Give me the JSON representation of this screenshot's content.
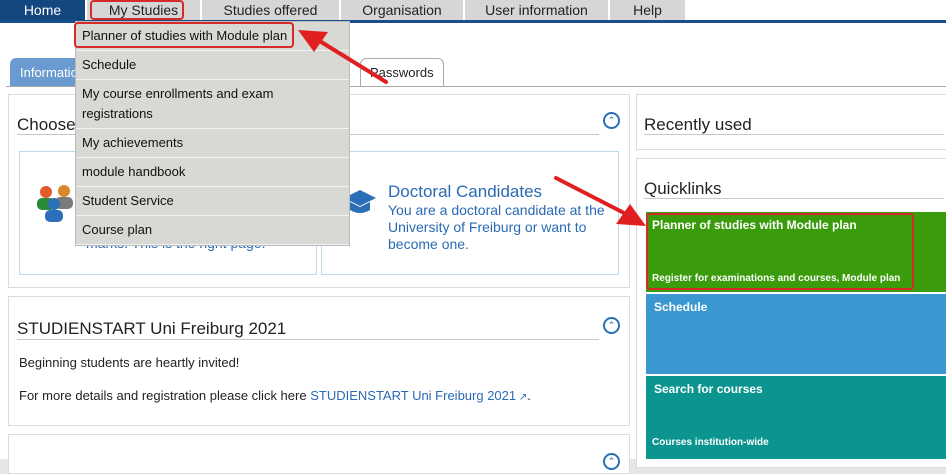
{
  "topnav": {
    "home": "Home",
    "my_studies": "My Studies",
    "studies_offered": "Studies offered",
    "organisation": "Organisation",
    "user_information": "User information",
    "help": "Help"
  },
  "tabs": {
    "information": "Informatio",
    "passwords": "Passwords"
  },
  "dropdown": {
    "items": [
      "Planner of studies with Module plan",
      "Schedule",
      "My course enrollments and exam registrations",
      "My achievements",
      "module handbook",
      "Student Service",
      "Course plan"
    ]
  },
  "choose_panel": {
    "title": "Choose",
    "students_text": "register for courses or check your marks. This is the right page.",
    "doctoral_title": "Doctoral Candidates",
    "doctoral_text": "You are a doctoral candidate at the University of Freiburg or want to become one."
  },
  "studienstart_panel": {
    "title": "STUDIENSTART Uni Freiburg 2021",
    "line1": "Beginning students are heartly invited!",
    "line2": "For more details and registration please click here",
    "link": "STUDIENSTART Uni Freiburg 2021",
    "after_link": "."
  },
  "recently_used": {
    "title": "Recently used"
  },
  "quicklinks": {
    "title": "Quicklinks",
    "tiles": [
      {
        "title": "Planner of studies with Module plan",
        "sub": "Register for examinations and courses, Module plan",
        "color": "#3a9b0b"
      },
      {
        "title": "Schedule",
        "sub": "",
        "color": "#3a97cf"
      },
      {
        "title": "Search for courses",
        "sub": "Courses institution-wide",
        "color": "#0c9590"
      }
    ]
  },
  "colors": {
    "home_bg": "#14467f",
    "highlight": "#d62a2a",
    "link": "#2a6ab3"
  }
}
